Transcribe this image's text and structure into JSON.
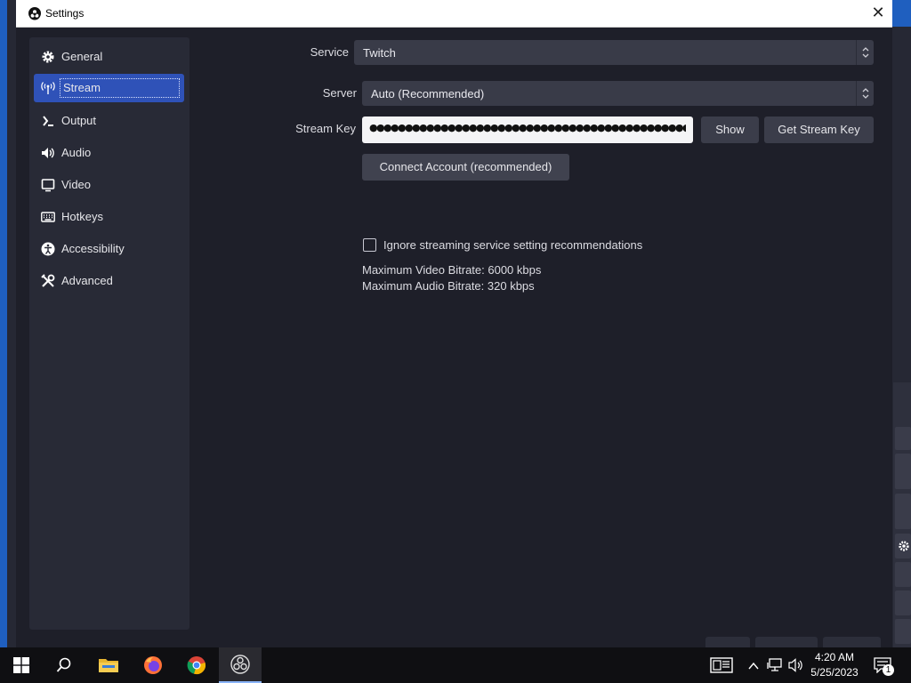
{
  "window": {
    "title": "Settings",
    "close_glyph": "✕",
    "app_icon": "obs-icon"
  },
  "sidebar": {
    "items": [
      {
        "label": "General",
        "icon": "gear-icon"
      },
      {
        "label": "Stream",
        "icon": "antenna-icon",
        "active": true
      },
      {
        "label": "Output",
        "icon": "output-icon"
      },
      {
        "label": "Audio",
        "icon": "speaker-icon"
      },
      {
        "label": "Video",
        "icon": "monitor-icon"
      },
      {
        "label": "Hotkeys",
        "icon": "keyboard-icon"
      },
      {
        "label": "Accessibility",
        "icon": "accessibility-icon"
      },
      {
        "label": "Advanced",
        "icon": "tools-icon"
      }
    ]
  },
  "stream": {
    "service_label": "Service",
    "service_value": "Twitch",
    "server_label": "Server",
    "server_value": "Auto (Recommended)",
    "stream_key_label": "Stream Key",
    "stream_key_value": "●●●●●●●●●●●●●●●●●●●●●●●●●●●●●●●●●●●●●●●●●●●●●●●",
    "show_button": "Show",
    "get_stream_key_button": "Get Stream Key",
    "connect_account_button": "Connect Account (recommended)",
    "ignore_recommendations_label": "Ignore streaming service setting recommendations",
    "ignore_recommendations_checked": false,
    "max_video_bitrate": "Maximum Video Bitrate: 6000 kbps",
    "max_audio_bitrate": "Maximum Audio Bitrate: 320 kbps"
  },
  "taskbar": {
    "apps": [
      "windows-start-icon",
      "search-icon",
      "file-explorer-icon",
      "firefox-icon",
      "chrome-icon",
      "obs-icon"
    ],
    "time": "4:20 AM",
    "date": "5/25/2023",
    "notification_count": "1"
  },
  "colors": {
    "accent": "#2f52b8",
    "panel": "#282a36",
    "background": "#1e1f29",
    "control": "#393b48"
  }
}
